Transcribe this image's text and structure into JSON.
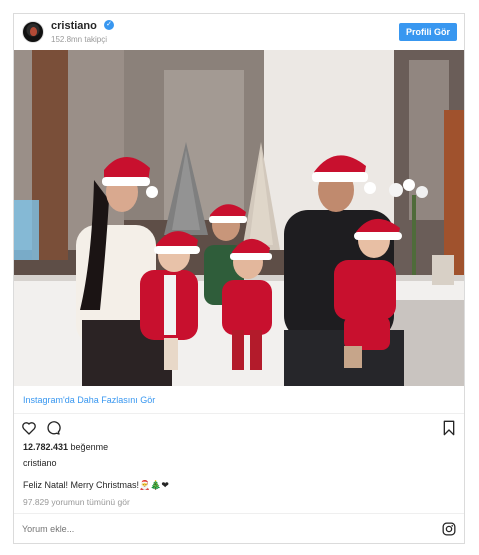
{
  "header": {
    "username": "cristiano",
    "verified_mark": "✓",
    "followers": "152.8mn takipçi",
    "profile_button": "Profili Gör"
  },
  "photo": {
    "icon": "family-christmas-photo"
  },
  "more_link": "Instagram'da Daha Fazlasını Gör",
  "actions": {
    "icons": [
      "heart-icon",
      "comment-icon",
      "bookmark-icon"
    ]
  },
  "likes_count": "12.782.431",
  "likes_label": " beğenme",
  "owner": "cristiano",
  "caption": "Feliz Natal! Merry Christmas!🎅🎄❤",
  "view_comments": "97.829 yorumun tümünü gör",
  "comment_placeholder": "Yorum ekle...",
  "colors": {
    "accent": "#3897f0",
    "text": "#262626",
    "muted": "#999999",
    "border": "#dbdbdb"
  }
}
